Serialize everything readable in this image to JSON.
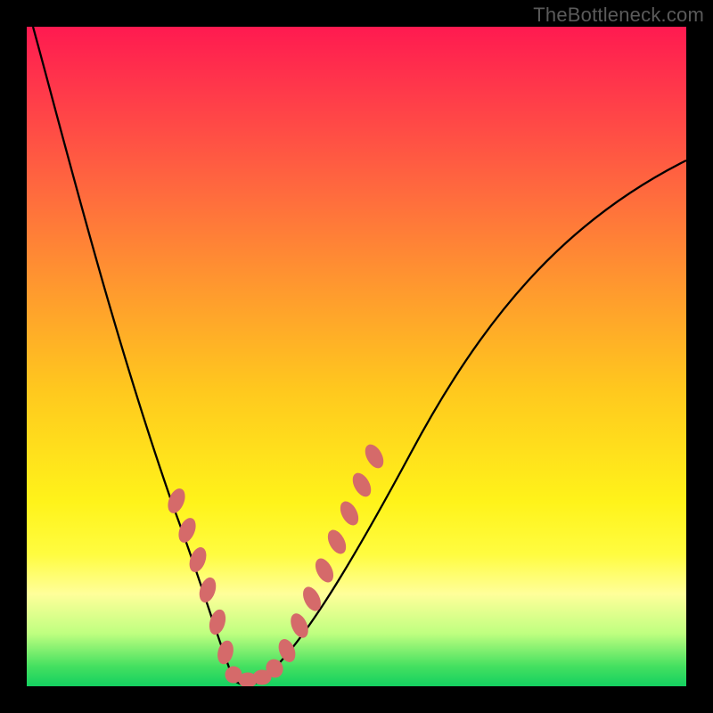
{
  "watermark": {
    "text": "TheBottleneck.com"
  },
  "chart_data": {
    "type": "line",
    "title": "",
    "xlabel": "",
    "ylabel": "",
    "xlim": [
      0,
      100
    ],
    "ylim": [
      0,
      100
    ],
    "grid": false,
    "series": [
      {
        "name": "bottleneck-curve",
        "color": "#000000",
        "x": [
          1,
          5,
          10,
          15,
          20,
          23,
          25,
          27,
          29,
          31,
          33,
          35,
          40,
          45,
          50,
          55,
          60,
          65,
          70,
          75,
          80,
          85,
          90,
          95,
          100
        ],
        "values": [
          100,
          85,
          68,
          52,
          38,
          30,
          22,
          14,
          6,
          1,
          0,
          1,
          6,
          14,
          22,
          30,
          38,
          45,
          52,
          58,
          64,
          69,
          73,
          77,
          80
        ]
      },
      {
        "name": "highlight-markers",
        "color": "#d56a6a",
        "x": [
          22,
          23.5,
          25,
          26,
          27,
          28.5,
          30,
          31,
          32,
          33,
          34.5,
          36,
          37.5,
          39,
          40.5,
          42,
          43.5,
          45
        ],
        "values": [
          28,
          23,
          16,
          12,
          8,
          4,
          1,
          0.5,
          0.5,
          0.8,
          1.2,
          3,
          7,
          12,
          18,
          24,
          30,
          33
        ]
      }
    ],
    "gradient_stops": [
      {
        "pos": 0,
        "color": "#ff1a50"
      },
      {
        "pos": 25,
        "color": "#ff6a3e"
      },
      {
        "pos": 55,
        "color": "#ffc81e"
      },
      {
        "pos": 80,
        "color": "#fffc40"
      },
      {
        "pos": 92,
        "color": "#bfff80"
      },
      {
        "pos": 100,
        "color": "#14d060"
      }
    ]
  }
}
